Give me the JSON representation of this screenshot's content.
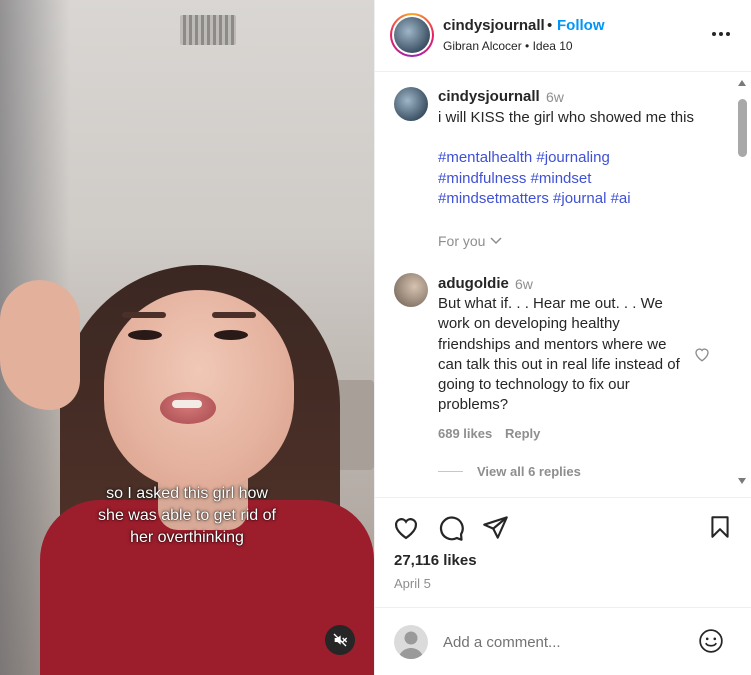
{
  "video": {
    "caption_lines": [
      "so I asked this girl how",
      "she was able to get rid of",
      "her overthinking"
    ],
    "mute_icon": "speaker-muted-icon"
  },
  "header": {
    "username": "cindysjournall",
    "separator": "•",
    "follow_label": "Follow",
    "subtitle": "Gibran Alcocer • Idea 10",
    "more_icon": "more-horizontal-icon"
  },
  "caption": {
    "username": "cindysjournall",
    "time": "6w",
    "text": "i will KISS the girl who showed me this",
    "hashtag_lines": [
      "#mentalhealth #journaling",
      "#mindfulness #mindset",
      "#mindsetmatters #journal #ai"
    ],
    "for_you_label": "For you"
  },
  "comment": {
    "username": "adugoldie",
    "time": "6w",
    "text": "But what if. . . Hear me out. . . We work on developing healthy friendships and mentors where we can talk this out in real life instead of going to technology to fix our problems?",
    "likes": "689 likes",
    "reply_label": "Reply",
    "view_replies": "View all 6 replies"
  },
  "actions": {
    "likes": "27,116 likes",
    "date": "April 5"
  },
  "comment_bar": {
    "placeholder": "Add a comment..."
  },
  "colors": {
    "accent": "#0095f6",
    "hashtag": "#3f51d6",
    "muted_text": "#8e8e8e"
  }
}
